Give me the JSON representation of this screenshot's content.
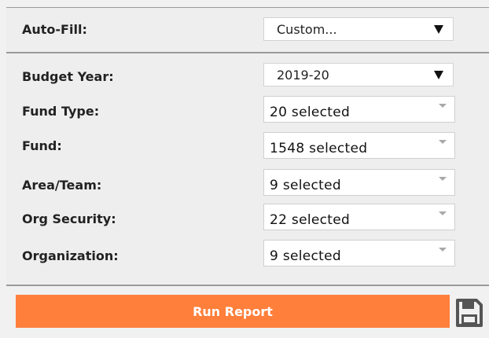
{
  "auto_fill": {
    "label": "Auto-Fill:",
    "value": "Custom..."
  },
  "budget_year": {
    "label": "Budget Year:",
    "value": "2019-20"
  },
  "filters": [
    {
      "id": "fund-type",
      "label": "Fund Type:",
      "value": "20 selected"
    },
    {
      "id": "fund",
      "label": "Fund:",
      "value": "1548 selected"
    },
    {
      "id": "area-team",
      "label": "Area/Team:",
      "value": "9 selected"
    },
    {
      "id": "org-security",
      "label": "Org Security:",
      "value": "22 selected"
    },
    {
      "id": "organization",
      "label": "Organization:",
      "value": "9 selected"
    }
  ],
  "actions": {
    "run_report_label": "Run Report",
    "save_icon": "floppy-disk-icon"
  },
  "colors": {
    "run_button": "#ff7f3b",
    "divider": "#9a9a9a"
  }
}
